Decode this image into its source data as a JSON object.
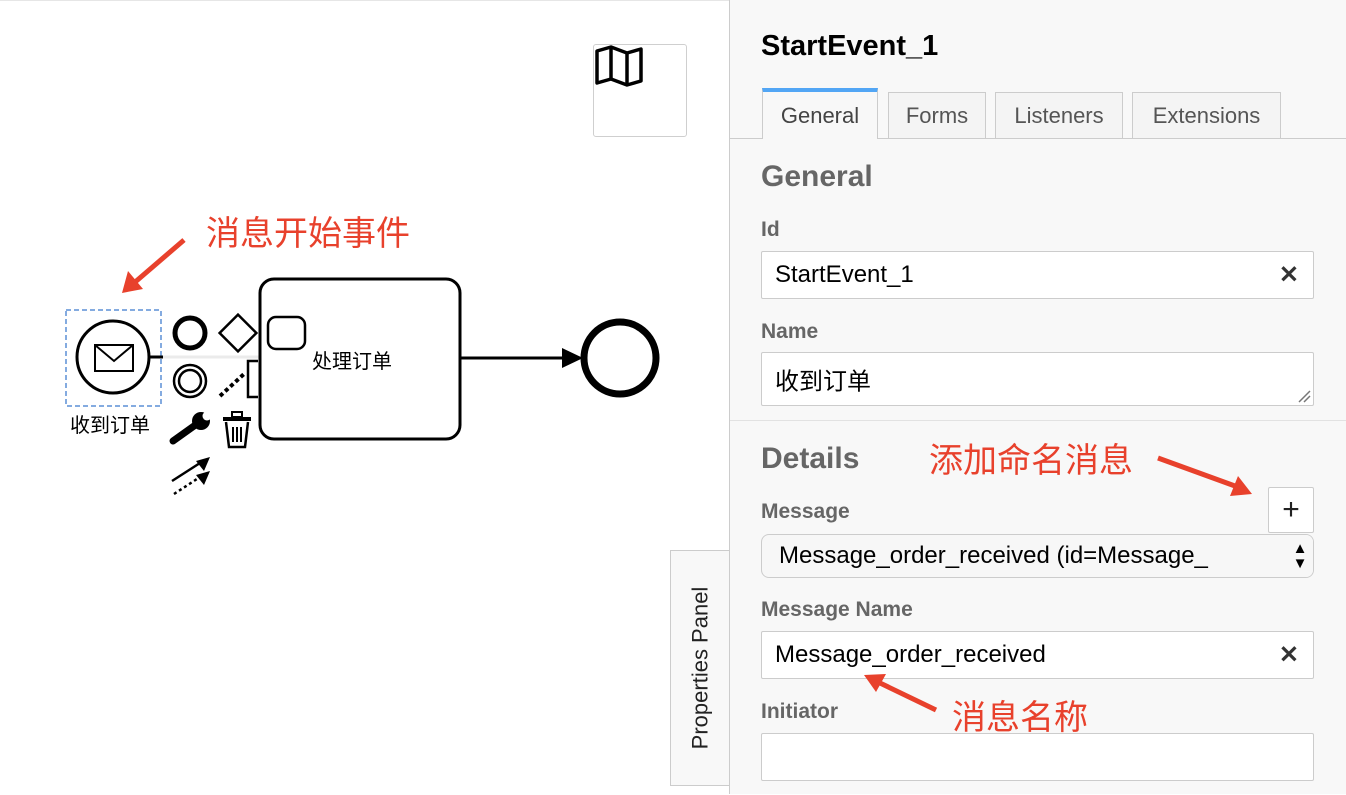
{
  "canvas": {
    "start_event_label": "收到订单",
    "task_label": "处理订单"
  },
  "annotations": {
    "start_event": "消息开始事件",
    "add_message": "添加命名消息",
    "message_name": "消息名称",
    "color": "#e8412c"
  },
  "panel": {
    "tab_label": "Properties Panel",
    "title": "StartEvent_1",
    "tabs": [
      {
        "label": "General",
        "active": true
      },
      {
        "label": "Forms",
        "active": false
      },
      {
        "label": "Listeners",
        "active": false
      },
      {
        "label": "Extensions",
        "active": false
      }
    ],
    "general": {
      "group_title": "General",
      "id_label": "Id",
      "id_value": "StartEvent_1",
      "name_label": "Name",
      "name_value": "收到订单"
    },
    "details": {
      "group_title": "Details",
      "message_label": "Message",
      "message_selected": "Message_order_received (id=Message_",
      "message_name_label": "Message Name",
      "message_name_value": "Message_order_received",
      "initiator_label": "Initiator",
      "initiator_value": ""
    },
    "accent_color": "#52a6f5"
  }
}
